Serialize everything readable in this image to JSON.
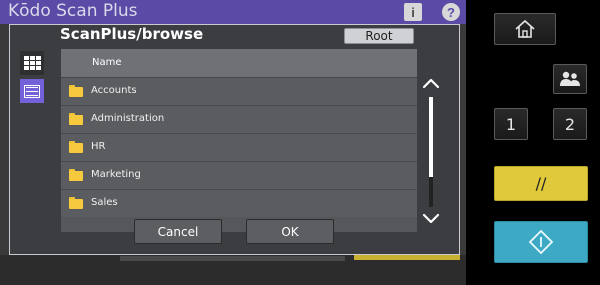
{
  "app": {
    "title": "Kōdo Scan Plus"
  },
  "dialog": {
    "title": "ScanPlus/browse",
    "root_label": "Root",
    "cancel_label": "Cancel",
    "ok_label": "OK",
    "column_header": "Name",
    "folders": [
      "Accounts",
      "Administration",
      "HR",
      "Marketing",
      "Sales"
    ]
  },
  "panel": {
    "key_1": "1",
    "key_2": "2",
    "clear_label": "//"
  },
  "colors": {
    "title_bar": "#5b4aa6",
    "list_view_selected": "#7262d9",
    "folder_icon": "#f7c93d",
    "clear_key": "#e0c93a",
    "start_key": "#3ea9c4"
  },
  "icons": {
    "info": "info-icon",
    "help": "help-icon",
    "grid_view": "grid-view-icon",
    "list_view": "list-view-icon",
    "folder": "folder-icon",
    "home": "home-icon",
    "users": "users-icon",
    "start": "start-icon"
  }
}
